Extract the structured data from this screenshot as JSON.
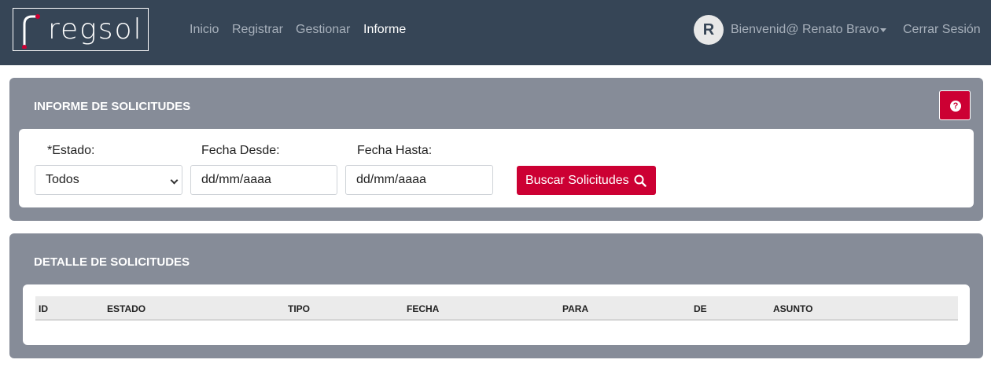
{
  "brand": {
    "logo_text": "regsol",
    "accent": "#cc0033",
    "nav_bg": "#364556"
  },
  "nav": {
    "links": [
      {
        "label": "Inicio",
        "active": false
      },
      {
        "label": "Registrar",
        "active": false
      },
      {
        "label": "Gestionar",
        "active": false
      },
      {
        "label": "Informe",
        "active": true
      }
    ],
    "avatar_initial": "R",
    "welcome": "Bienvenid@ Renato Bravo",
    "logout": "Cerrar Sesión"
  },
  "report_panel": {
    "title": "INFORME DE SOLICITUDES",
    "help_icon": "question-circle-icon",
    "estado_label": "*Estado:",
    "estado_value": "Todos",
    "desde_label": "Fecha Desde:",
    "desde_value": "dd/mm/aaaa",
    "hasta_label": "Fecha Hasta:",
    "hasta_value": "dd/mm/aaaa",
    "search_button": "Buscar Solicitudes",
    "search_icon": "search-icon"
  },
  "detail_panel": {
    "title": "DETALLE DE SOLICITUDES",
    "columns": [
      "ID",
      "ESTADO",
      "TIPO",
      "FECHA",
      "PARA",
      "DE",
      "ASUNTO"
    ]
  }
}
